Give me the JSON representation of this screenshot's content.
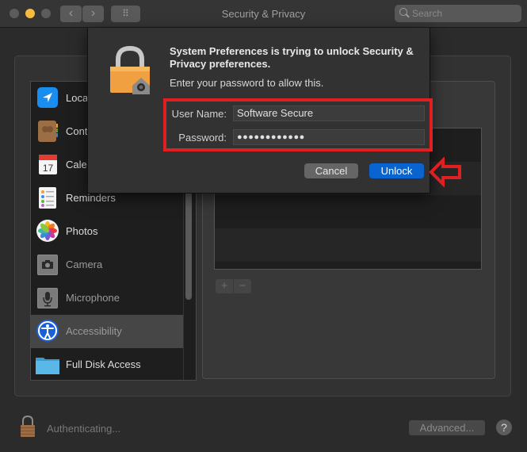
{
  "window": {
    "title": "Security & Privacy",
    "search_placeholder": "Search",
    "back_label": "‹",
    "forward_label": "›",
    "grid_label": "⠿"
  },
  "sidebar": {
    "items": [
      {
        "label": "Location Services",
        "visible_label": "Loca",
        "icon": "location-arrow-icon"
      },
      {
        "label": "Contacts",
        "visible_label": "Cont",
        "icon": "contacts-book-icon"
      },
      {
        "label": "Calendars",
        "visible_label": "Cale",
        "icon": "calendar-icon"
      },
      {
        "label": "Reminders",
        "visible_label": "Reminders",
        "icon": "reminders-list-icon"
      },
      {
        "label": "Photos",
        "visible_label": "Photos",
        "icon": "photos-flower-icon"
      },
      {
        "label": "Camera",
        "visible_label": "Camera",
        "icon": "camera-icon"
      },
      {
        "label": "Microphone",
        "visible_label": "Microphone",
        "icon": "microphone-icon"
      },
      {
        "label": "Accessibility",
        "visible_label": "Accessibility",
        "icon": "accessibility-icon",
        "selected": true
      },
      {
        "label": "Full Disk Access",
        "visible_label": "Full Disk Access",
        "icon": "folder-icon"
      }
    ]
  },
  "list_controls": {
    "add_label": "+",
    "remove_label": "−"
  },
  "footer": {
    "status_text": "Authenticating...",
    "advanced_label": "Advanced...",
    "help_label": "?"
  },
  "dialog": {
    "title": "System Preferences is trying to unlock Security & Privacy preferences.",
    "subtitle": "Enter your password to allow this.",
    "username_label": "User Name:",
    "username_value": "Software Secure",
    "password_label": "Password:",
    "password_value": "●●●●●●●●●●●●",
    "cancel_label": "Cancel",
    "unlock_label": "Unlock"
  },
  "colors": {
    "highlight": "#e02020",
    "accent": "#0a64d0"
  }
}
